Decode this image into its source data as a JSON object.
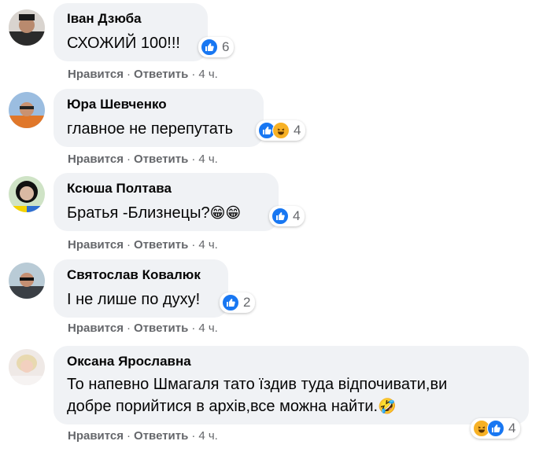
{
  "actions": {
    "like_label": "Нравится",
    "reply_label": "Ответить",
    "separator": "·"
  },
  "colors": {
    "like": "#1877f2",
    "haha": "#f7b125",
    "bubble": "#f0f2f5",
    "meta": "#65676b"
  },
  "comments": [
    {
      "author": "Іван Дзюба",
      "text": "СХОЖИЙ 100!!!",
      "emoji": "",
      "reactions": [
        "like-icon"
      ],
      "reaction_count": "6",
      "time": "4 ч."
    },
    {
      "author": "Юра Шевченко",
      "text": "главное не перепутать",
      "emoji": "",
      "reactions": [
        "like-icon",
        "haha-icon"
      ],
      "reaction_count": "4",
      "time": "4 ч."
    },
    {
      "author": "Ксюша Полтава",
      "text": "Братья -Близнецы?",
      "emoji": "😁😁",
      "reactions": [
        "like-icon"
      ],
      "reaction_count": "4",
      "time": "4 ч."
    },
    {
      "author": "Святослав Ковалюк",
      "text": "І не лише по духу!",
      "emoji": "",
      "reactions": [
        "like-icon"
      ],
      "reaction_count": "2",
      "time": "4 ч."
    },
    {
      "author": "Оксана Ярославна",
      "text_line1": "То напевно Шмагаля тато їздив туда відпочивати,ви",
      "text_line2": "добре порийтися в архів,все можна найти.",
      "emoji": "🤣",
      "reactions": [
        "haha-icon",
        "like-icon"
      ],
      "reaction_count": "4",
      "time": "4 ч."
    }
  ]
}
